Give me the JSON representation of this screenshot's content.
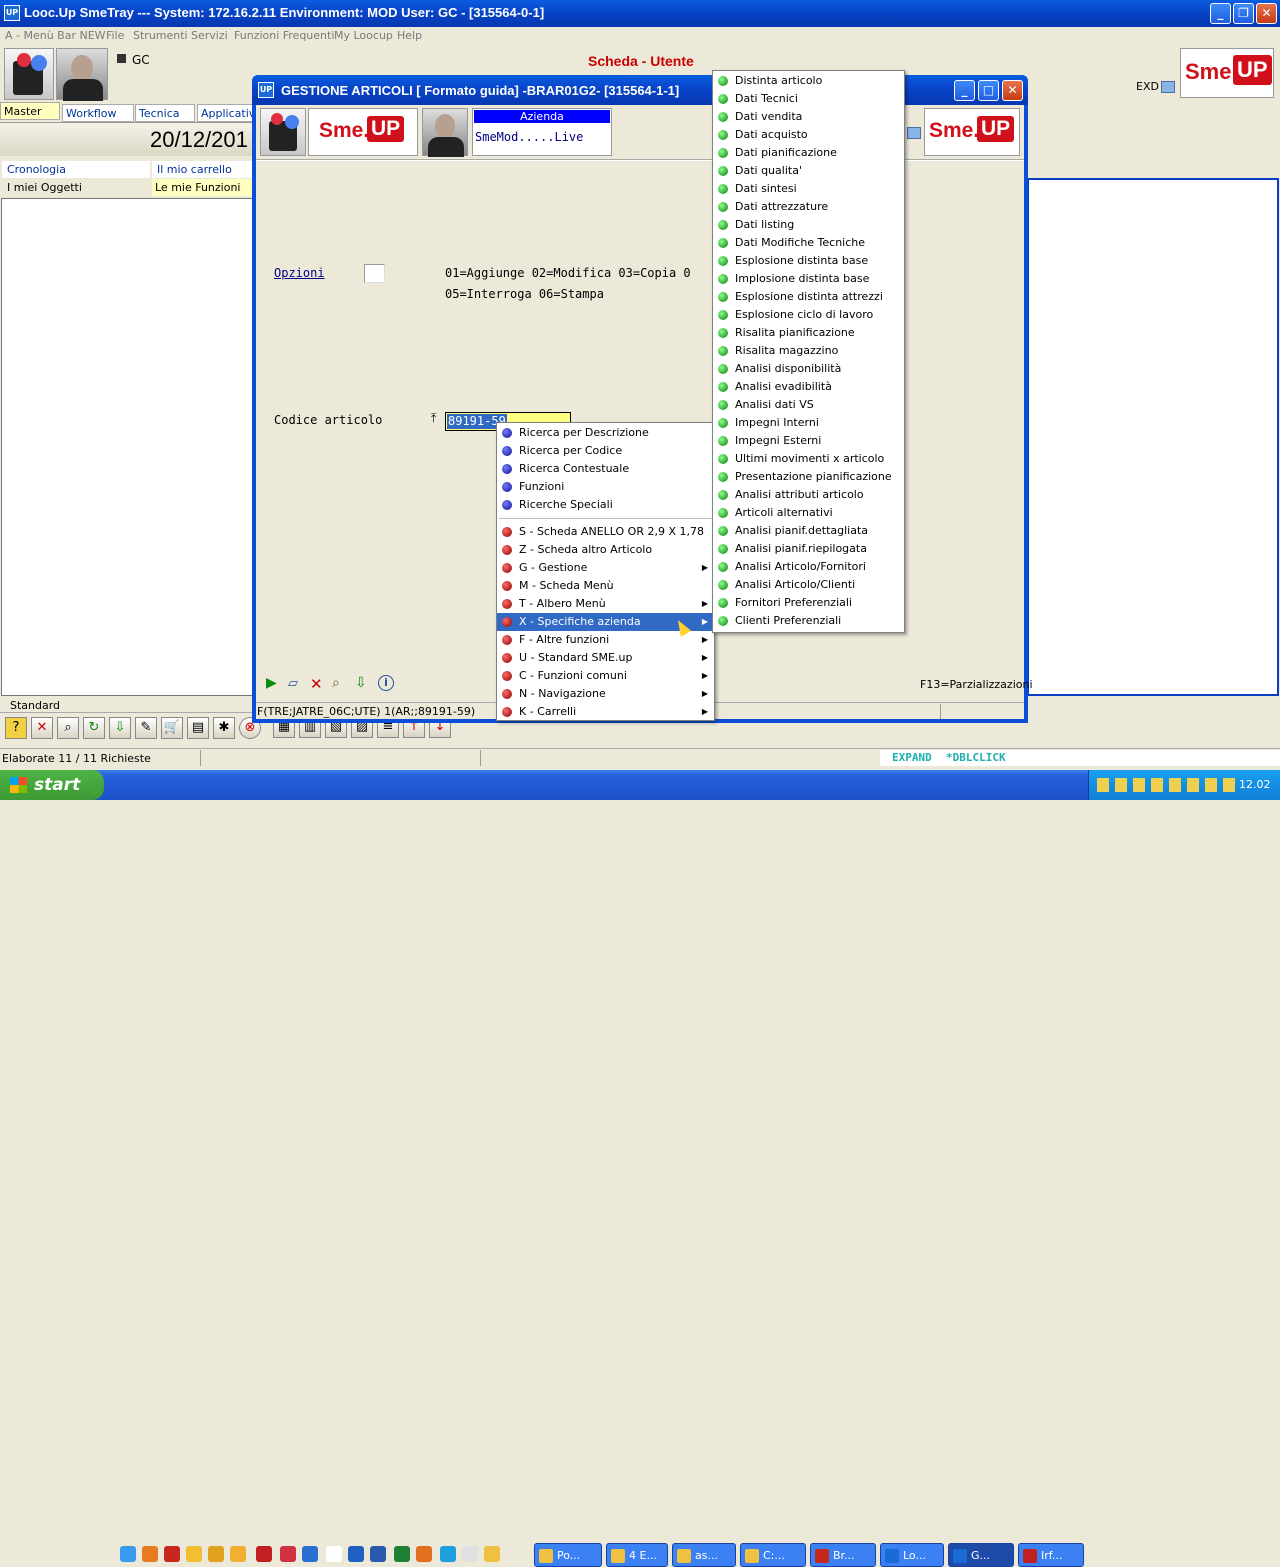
{
  "main_window": {
    "title": "Looc.Up SmeTray --- System: 172.16.2.11 Environment: MOD User: GC - [315564-0-1]",
    "app_icon": "UP",
    "menubar": [
      "A - Menù Bar NEW",
      "File",
      "Strumenti",
      "Servizi",
      "Funzioni Frequenti",
      "My Loocup",
      "Help"
    ],
    "user_code": "GC",
    "scheda_title": "Scheda - Utente",
    "exd_label": "EXD",
    "date": "20/12/201",
    "tabs": [
      "Master",
      "Workflow",
      "Tecnica",
      "Applicativ"
    ],
    "left_links": [
      "Cronologia",
      "Il mio carrello",
      "I miei Oggetti",
      "Le mie Funzioni"
    ],
    "standard_label": "Standard",
    "status_text": "Elaborate 11 / 11 Richieste",
    "expand_text": "EXPAND",
    "dblclick_text": "*DBLCLICK"
  },
  "dialog": {
    "title": "GESTIONE ARTICOLI [ Formato guida] -BRAR01G2- [315564-1-1]",
    "azienda_label": "Azienda",
    "azienda_value": "SmeMod.....Live",
    "options_label": "Opzioni",
    "options_line1": "01=Aggiunge 02=Modifica 03=Copia 0",
    "options_line2": "05=Interroga 06=Stampa",
    "codice_label": "Codice articolo",
    "codice_value": "89191-59",
    "f13_label": "F13=Parzializzazioni",
    "status_line": "F(TRE;JATRE_06C;UTE) 1(AR;;89191-59)"
  },
  "logos": {
    "sme_text": "Sme.",
    "up_text": "UP"
  },
  "context_menu": {
    "search_items": [
      "Ricerca per Descrizione",
      "Ricerca per Codice",
      "Ricerca Contestuale",
      "Funzioni",
      "Ricerche Speciali"
    ],
    "action_items": [
      {
        "label": "S - Scheda ANELLO OR 2,9 X 1,78",
        "submenu": false
      },
      {
        "label": "Z - Scheda altro Articolo",
        "submenu": false
      },
      {
        "label": "G - Gestione",
        "submenu": true
      },
      {
        "label": "M - Scheda Menù",
        "submenu": false
      },
      {
        "label": "T - Albero Menù",
        "submenu": true
      },
      {
        "label": "X - Specifiche azienda",
        "submenu": true,
        "selected": true
      },
      {
        "label": "F - Altre funzioni",
        "submenu": true
      },
      {
        "label": "U - Standard SME.up",
        "submenu": true
      },
      {
        "label": "C - Funzioni comuni",
        "submenu": true
      },
      {
        "label": "N - Navigazione",
        "submenu": true
      },
      {
        "label": "K - Carrelli",
        "submenu": true
      }
    ]
  },
  "submenu": {
    "items": [
      "Distinta articolo",
      "Dati Tecnici",
      "Dati vendita",
      "Dati acquisto",
      "Dati pianificazione",
      "Dati qualita'",
      "Dati sintesi",
      "Dati attrezzature",
      "Dati listing",
      "Dati Modifiche Tecniche",
      "Esplosione distinta base",
      "Implosione distinta base",
      "Esplosione distinta attrezzi",
      "Esplosione ciclo di lavoro",
      "Risalita pianificazione",
      "Risalita magazzino",
      "Analisi disponibilità",
      "Analisi evadibilità",
      "Analisi dati VS",
      "Impegni Interni",
      "Impegni Esterni",
      "Ultimi movimenti x articolo",
      "Presentazione pianificazione",
      "Analisi attributi articolo",
      "Articoli alternativi",
      "Analisi pianif.dettagliata",
      "Analisi pianif.riepilogata",
      "Analisi Articolo/Fornitori",
      "Analisi Articolo/Clienti",
      "Fornitori Preferenziali",
      "Clienti Preferenziali"
    ]
  },
  "taskbar": {
    "start_label": "start",
    "tasks": [
      "Po...",
      "4 E...",
      "as...",
      "C:...",
      "Br...",
      "Lo...",
      "G...",
      "Irf..."
    ],
    "clock": "12.02"
  },
  "colors": {
    "xp_blue": "#0a5de0",
    "menu_selected": "#316ac5",
    "sme_red": "#d0101a",
    "taskbar": "#245edb",
    "start_green": "#3c9a34"
  }
}
